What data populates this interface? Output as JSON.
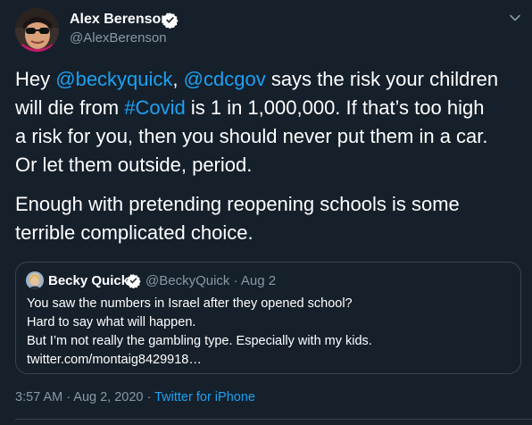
{
  "author": {
    "name": "Alex Berenson",
    "handle": "@AlexBerenson"
  },
  "tweet": {
    "p1": {
      "l1_pre": "Hey ",
      "mention_1": "@beckyquick",
      "l1_mid": ", ",
      "mention_2": "@cdcgov",
      "l1_post": " says the risk your children",
      "l2_pre": "will die from ",
      "hashtag": "#Covid",
      "l2_post": " is 1 in 1,000,000. If that’s too high",
      "l3": "a risk for you, then you should never put them in a car.",
      "l4": "Or let them outside, period."
    },
    "p2": {
      "l1": "Enough with pretending reopening schools is some",
      "l2": "terrible complicated choice."
    }
  },
  "quote": {
    "name": "Becky Quick",
    "handle_date": "@BeckyQuick · Aug 2",
    "lines": [
      "You saw the numbers in Israel after they opened school?",
      "Hard to say what will happen.",
      "But I’m not really the gambling type. Especially with my kids.",
      "twitter.com/montaig8429918…"
    ]
  },
  "meta": {
    "timestamp": "3:57 AM · Aug 2, 2020 · ",
    "source": "Twitter for iPhone"
  },
  "colors": {
    "background": "#15202b",
    "link": "#1da1f2",
    "secondary_text": "#8899a6",
    "border": "#38444d"
  }
}
